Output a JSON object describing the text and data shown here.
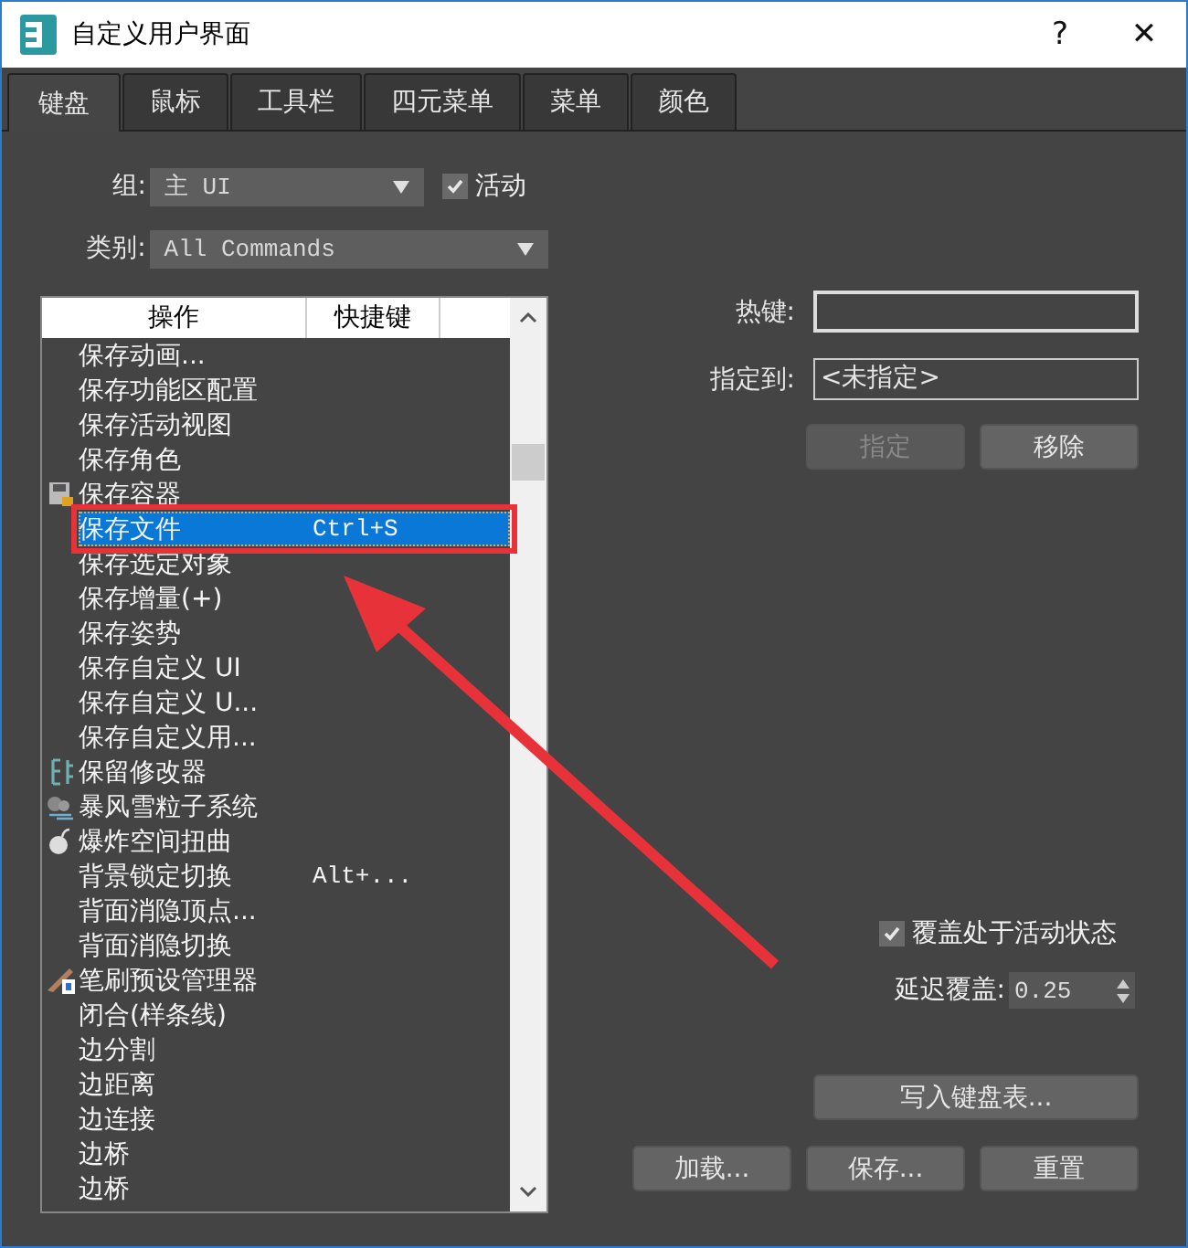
{
  "window": {
    "title": "自定义用户界面",
    "help": "?",
    "close": "✕"
  },
  "tabs": [
    {
      "label": "键盘",
      "selected": true
    },
    {
      "label": "鼠标",
      "selected": false
    },
    {
      "label": "工具栏",
      "selected": false
    },
    {
      "label": "四元菜单",
      "selected": false
    },
    {
      "label": "菜单",
      "selected": false
    },
    {
      "label": "颜色",
      "selected": false
    }
  ],
  "group": {
    "label": "组:",
    "value": "主 UI",
    "active": {
      "label": "活动",
      "checked": true
    }
  },
  "category": {
    "label": "类别:",
    "value": "All Commands"
  },
  "list": {
    "columns": [
      "操作",
      "快捷键"
    ],
    "rows": [
      {
        "action": "保存动画...",
        "shortcut": "",
        "kind": "plain",
        "selected": false
      },
      {
        "action": "保存功能区配置",
        "shortcut": "",
        "kind": "plain",
        "selected": false
      },
      {
        "action": "保存活动视图",
        "shortcut": "",
        "kind": "plain",
        "selected": false
      },
      {
        "action": "保存角色",
        "shortcut": "",
        "kind": "plain",
        "selected": false
      },
      {
        "action": "保存容器",
        "shortcut": "",
        "kind": "disk",
        "selected": false
      },
      {
        "action": "保存文件",
        "shortcut": "Ctrl+S",
        "kind": "plain",
        "selected": true
      },
      {
        "action": "保存选定对象",
        "shortcut": "",
        "kind": "plain",
        "selected": false
      },
      {
        "action": "保存增量(+)",
        "shortcut": "",
        "kind": "plain",
        "selected": false
      },
      {
        "action": "保存姿势",
        "shortcut": "",
        "kind": "plain",
        "selected": false
      },
      {
        "action": "保存自定义 UI",
        "shortcut": "",
        "kind": "plain",
        "selected": false
      },
      {
        "action": "保存自定义 U...",
        "shortcut": "",
        "kind": "plain",
        "selected": false
      },
      {
        "action": "保存自定义用...",
        "shortcut": "",
        "kind": "plain",
        "selected": false
      },
      {
        "action": "保留修改器",
        "shortcut": "",
        "kind": "modifier",
        "selected": false
      },
      {
        "action": "暴风雪粒子系统",
        "shortcut": "",
        "kind": "particles",
        "selected": false
      },
      {
        "action": "爆炸空间扭曲",
        "shortcut": "",
        "kind": "bomb",
        "selected": false
      },
      {
        "action": "背景锁定切换",
        "shortcut": "Alt+...",
        "kind": "plain",
        "selected": false
      },
      {
        "action": "背面消隐顶点...",
        "shortcut": "",
        "kind": "plain",
        "selected": false
      },
      {
        "action": "背面消隐切换",
        "shortcut": "",
        "kind": "plain",
        "selected": false
      },
      {
        "action": "笔刷预设管理器",
        "shortcut": "",
        "kind": "brush",
        "selected": false
      },
      {
        "action": "闭合(样条线)",
        "shortcut": "",
        "kind": "plain",
        "selected": false
      },
      {
        "action": "边分割",
        "shortcut": "",
        "kind": "plain",
        "selected": false
      },
      {
        "action": "边距离",
        "shortcut": "",
        "kind": "plain",
        "selected": false
      },
      {
        "action": "边连接",
        "shortcut": "",
        "kind": "plain",
        "selected": false
      },
      {
        "action": "边桥",
        "shortcut": "",
        "kind": "plain",
        "selected": false
      },
      {
        "action": "边桥",
        "shortcut": "",
        "kind": "plain",
        "selected": false
      }
    ]
  },
  "hotkey": {
    "label": "热键:"
  },
  "assigned": {
    "label": "指定到:",
    "value": "<未指定>"
  },
  "assign_button": {
    "label": "指定",
    "disabled": true
  },
  "remove_button": {
    "label": "移除",
    "disabled": false
  },
  "override": {
    "label": "覆盖处于活动状态",
    "checked": true
  },
  "delay": {
    "label": "延迟覆盖:",
    "value": "0.25"
  },
  "buttons": [
    "写入键盘表...",
    "加载...",
    "保存...",
    "重置"
  ]
}
